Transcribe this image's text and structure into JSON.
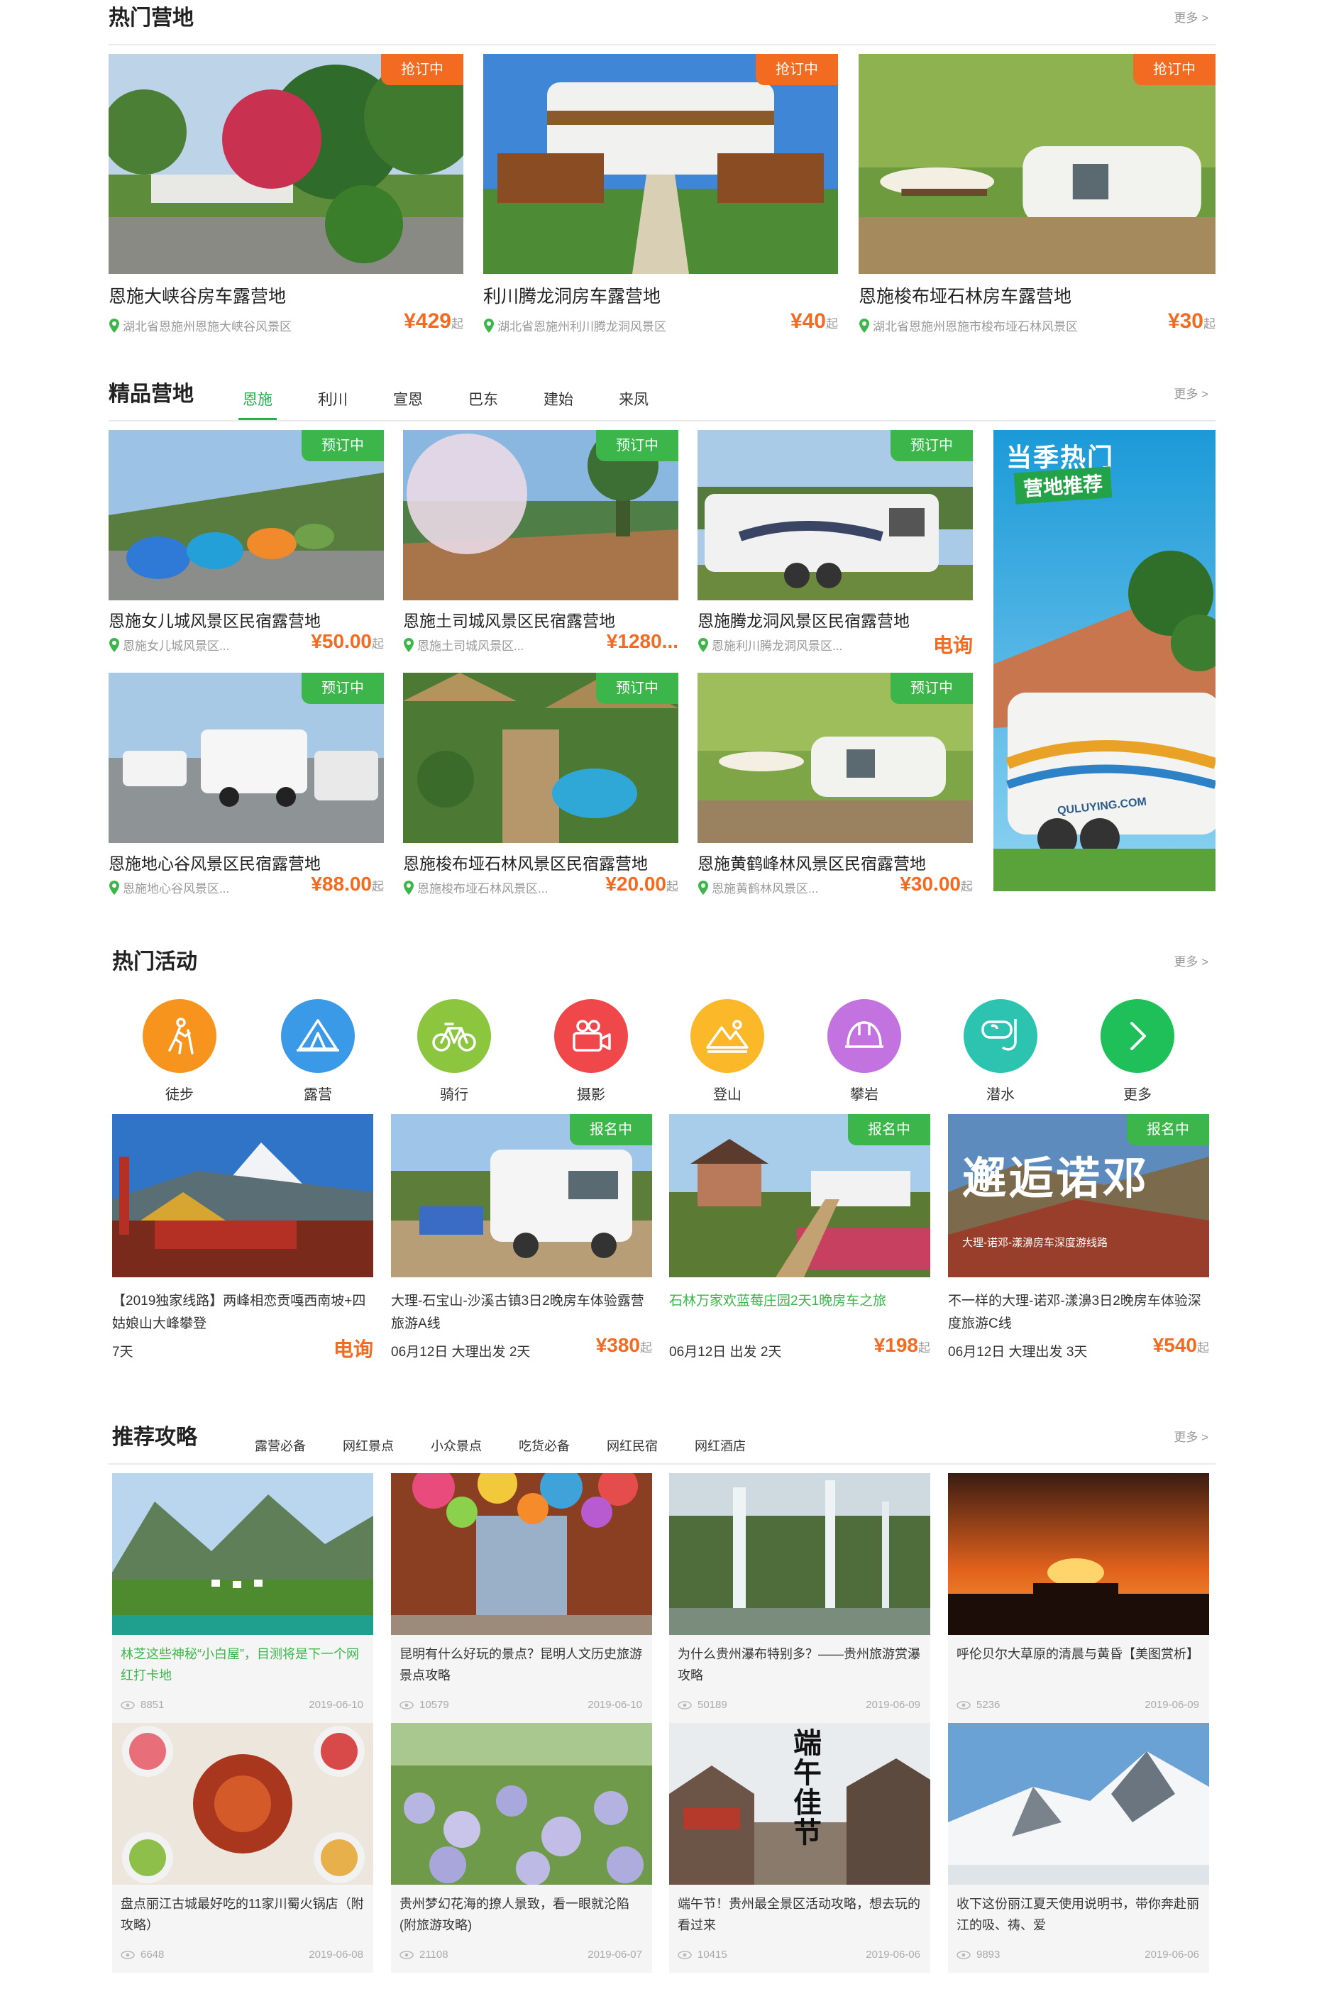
{
  "hot_camps": {
    "title": "热门营地",
    "more": "更多 >",
    "items": [
      {
        "badge": "抢订中",
        "name": "恩施大峡谷房车露营地",
        "location": "湖北省恩施州恩施大峡谷风景区",
        "price": "¥429",
        "unit": "起"
      },
      {
        "badge": "抢订中",
        "name": "利川腾龙洞房车露营地",
        "location": "湖北省恩施州利川腾龙洞风景区",
        "price": "¥40",
        "unit": "起"
      },
      {
        "badge": "抢订中",
        "name": "恩施梭布垭石林房车露营地",
        "location": "湖北省恩施州恩施市梭布垭石林风景区",
        "price": "¥30",
        "unit": "起"
      }
    ]
  },
  "premium_camps": {
    "title": "精品营地",
    "more": "更多 >",
    "tabs": [
      "恩施",
      "利川",
      "宣恩",
      "巴东",
      "建始",
      "来凤"
    ],
    "items": [
      {
        "badge": "预订中",
        "name": "恩施女儿城风景区民宿露营地",
        "location": "恩施女儿城风景区...",
        "price": "¥50.00",
        "unit": "起"
      },
      {
        "badge": "预订中",
        "name": "恩施土司城风景区民宿露营地",
        "location": "恩施土司城风景区...",
        "price": "¥1280...",
        "unit": ""
      },
      {
        "badge": "预订中",
        "name": "恩施腾龙洞风景区民宿露营地",
        "location": "恩施利川腾龙洞风景区...",
        "price": "电询",
        "unit": ""
      },
      {
        "badge": "预订中",
        "name": "恩施地心谷风景区民宿露营地",
        "location": "恩施地心谷风景区...",
        "price": "¥88.00",
        "unit": "起"
      },
      {
        "badge": "预订中",
        "name": "恩施梭布垭石林风景区民宿露营地",
        "location": "恩施梭布垭石林风景区...",
        "price": "¥20.00",
        "unit": "起"
      },
      {
        "badge": "预订中",
        "name": "恩施黄鹤峰林风景区民宿露营地",
        "location": "恩施黄鹤林风景区...",
        "price": "¥30.00",
        "unit": "起"
      }
    ],
    "promo": {
      "line1": "当季热门",
      "line2": "营地推荐",
      "watermark": "QULUYING.COM"
    }
  },
  "activities": {
    "title": "热门活动",
    "more": "更多 >",
    "categories": [
      {
        "label": "徒步",
        "icon": "hiking-icon",
        "color": "#f7941d"
      },
      {
        "label": "露营",
        "icon": "tent-icon",
        "color": "#3a9ae8"
      },
      {
        "label": "骑行",
        "icon": "bicycle-icon",
        "color": "#8cc63f"
      },
      {
        "label": "摄影",
        "icon": "camera-icon",
        "color": "#f0474b"
      },
      {
        "label": "登山",
        "icon": "mountain-icon",
        "color": "#fbb829"
      },
      {
        "label": "攀岩",
        "icon": "helmet-icon",
        "color": "#c273e0"
      },
      {
        "label": "潜水",
        "icon": "diving-mask-icon",
        "color": "#2cc4b0"
      },
      {
        "label": "更多",
        "icon": "chevron-right-icon",
        "color": "#1fbf5a"
      }
    ],
    "items": [
      {
        "badge": "",
        "desc": "【2019独家线路】两峰相恋贡嘎西南坡+四姑娘山大峰攀登",
        "meta": "7天",
        "price": "电询",
        "unit": ""
      },
      {
        "badge": "报名中",
        "desc": "大理-石宝山-沙溪古镇3日2晚房车体验露营旅游A线",
        "meta": "06月12日 大理出发 2天",
        "price": "¥380",
        "unit": "起"
      },
      {
        "badge": "报名中",
        "desc": "石林万家欢蓝莓庄园2天1晚房车之旅",
        "meta": "06月12日 出发 2天",
        "price": "¥198",
        "unit": "起"
      },
      {
        "badge": "报名中",
        "desc": "不一样的大理-诺邓-漾濞3日2晚房车体验深度旅游C线",
        "meta": "06月12日 大理出发 3天",
        "price": "¥540",
        "unit": "起",
        "img_text": "邂逅诺邓",
        "img_sub": "大理-诺邓-漾濞房车深度游线路"
      }
    ]
  },
  "guides": {
    "title": "推荐攻略",
    "more": "更多 >",
    "tabs": [
      "露营必备",
      "网红景点",
      "小众景点",
      "吃货必备",
      "网红民宿",
      "网红酒店"
    ],
    "items": [
      {
        "desc": "林芝这些神秘“小白屋”，目测将是下一个网红打卡地",
        "views": "8851",
        "date": "2019-06-10"
      },
      {
        "desc": "昆明有什么好玩的景点？昆明人文历史旅游景点攻略",
        "views": "10579",
        "date": "2019-06-10"
      },
      {
        "desc": "为什么贵州瀑布特别多？——贵州旅游赏瀑攻略",
        "views": "50189",
        "date": "2019-06-09"
      },
      {
        "desc": "呼伦贝尔大草原的清晨与黄昏【美图赏析】",
        "views": "5236",
        "date": "2019-06-09"
      },
      {
        "desc": "盘点丽江古城最好吃的11家川蜀火锅店（附攻略）",
        "views": "6648",
        "date": "2019-06-08"
      },
      {
        "desc": "贵州梦幻花海的撩人景致，看一眼就沦陷(附旅游攻略)",
        "views": "21108",
        "date": "2019-06-07"
      },
      {
        "desc": "端午节！贵州最全景区活动攻略，想去玩的看过来",
        "views": "10415",
        "date": "2019-06-06",
        "img_text": "端午佳节"
      },
      {
        "desc": "收下这份丽江夏天使用说明书，带你奔赴丽江的吸、祷、爱",
        "views": "9893",
        "date": "2019-06-06"
      }
    ]
  }
}
